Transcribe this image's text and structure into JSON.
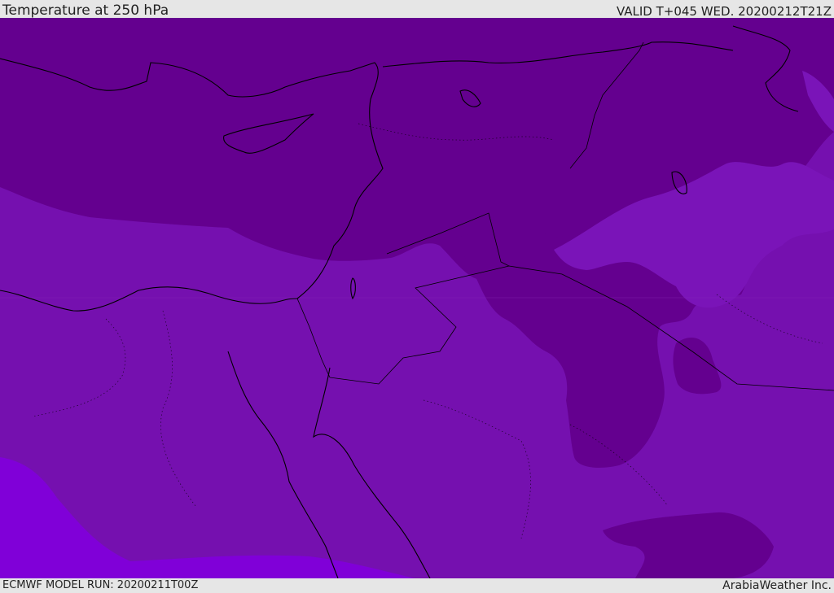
{
  "header": {
    "title": "Temperature at 250 hPa",
    "valid": "VALID T+045 WED. 20200212T21Z"
  },
  "footer": {
    "model_run": "ECMWF MODEL RUN: 20200211T00Z",
    "credit": "ArabiaWeather Inc."
  },
  "map": {
    "colors": {
      "band_cold": "#64008f",
      "band_mid": "#7510af",
      "band_warm": "#8000d8",
      "patch_light": "#7a14b8",
      "coast": "#000000"
    }
  }
}
